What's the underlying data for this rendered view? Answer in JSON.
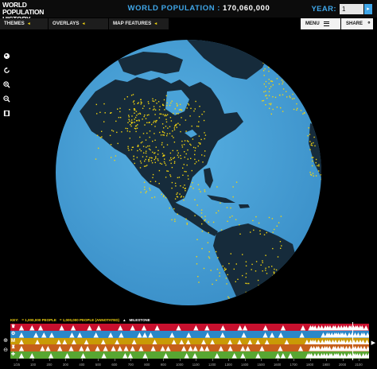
{
  "header": {
    "logo_line1": "WORLD POPULATION",
    "logo_line2": "HISTORY",
    "title_label": "WORLD POPULATION",
    "title_sep": ":",
    "population": "170,060,000",
    "year_label": "YEAR:",
    "year_value": "1"
  },
  "nav": {
    "themes": "THEMES",
    "overlays": "OVERLAYS",
    "map_features": "MAP FEATURES",
    "menu": "MENU",
    "share": "SHARE"
  },
  "side_icons": [
    "globe-icon",
    "rotate-icon",
    "zoom-in-icon",
    "zoom-out-icon",
    "film-icon"
  ],
  "key": {
    "label": "KEY:",
    "item1": "= 1,000,000 PEOPLE",
    "item2": "= 1,000,000 PEOPLE (ANNOTATED)",
    "item3": "MILESTONE"
  },
  "timeline_bands": [
    {
      "color": "#c8102e",
      "label": "♛"
    },
    {
      "color": "#2b87c8",
      "label": "⚙"
    },
    {
      "color": "#c99a06",
      "label": "M"
    },
    {
      "color": "#c65f1a",
      "label": "♜"
    },
    {
      "color": "#58a632",
      "label": "✚"
    }
  ],
  "axis_ticks": [
    "1/25",
    "100",
    "200",
    "300",
    "400",
    "500",
    "600",
    "700",
    "800",
    "900",
    "1000",
    "1100",
    "1200",
    "1300",
    "1400",
    "1500",
    "1600",
    "1700",
    "1800",
    "1900",
    "2000",
    "2100"
  ],
  "colors": {
    "ocean": "#4aa3d8",
    "land": "#162b3b",
    "dots": "#f2d40f",
    "accent": "#3fa6e8"
  }
}
